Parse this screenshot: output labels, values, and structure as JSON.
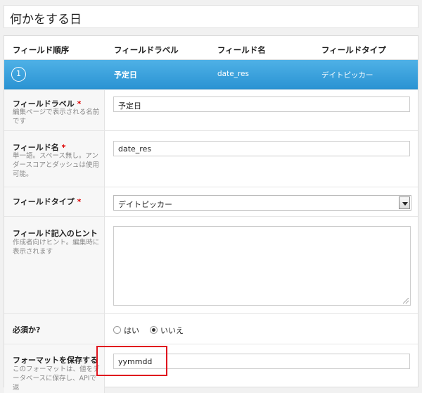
{
  "page": {
    "title": "何かをする日"
  },
  "columns": {
    "order": "フィールド順序",
    "label": "フィールドラベル",
    "name": "フィールド名",
    "type": "フィールドタイプ"
  },
  "field_row": {
    "number": "1",
    "label": "予定日",
    "name": "date_res",
    "type": "デイトピッカー"
  },
  "form": {
    "label": {
      "title": "フィールドラベル",
      "required": "*",
      "hint": "編集ページで表示される名前です",
      "value": "予定日"
    },
    "name": {
      "title": "フィールド名",
      "required": "*",
      "hint": "単一語。スペース無し。アンダースコアとダッシュは使用可能。",
      "value": "date_res"
    },
    "type": {
      "title": "フィールドタイプ",
      "required": "*",
      "value": "デイトピッカー"
    },
    "instructions": {
      "title": "フィールド記入のヒント",
      "hint": "作成者向けヒント。編集時に表示されます",
      "value": ""
    },
    "required_field": {
      "title": "必須か?",
      "yes": "はい",
      "no": "いいえ",
      "selected": "no"
    },
    "save_format": {
      "title": "フォーマットを保存する",
      "hint": "このフォーマットは、値をデータベースに保存し、APIで返",
      "value": "yymmdd"
    }
  },
  "colors": {
    "accent": "#2a93d3",
    "required": "#dd0000",
    "highlight": "#e0141e"
  }
}
